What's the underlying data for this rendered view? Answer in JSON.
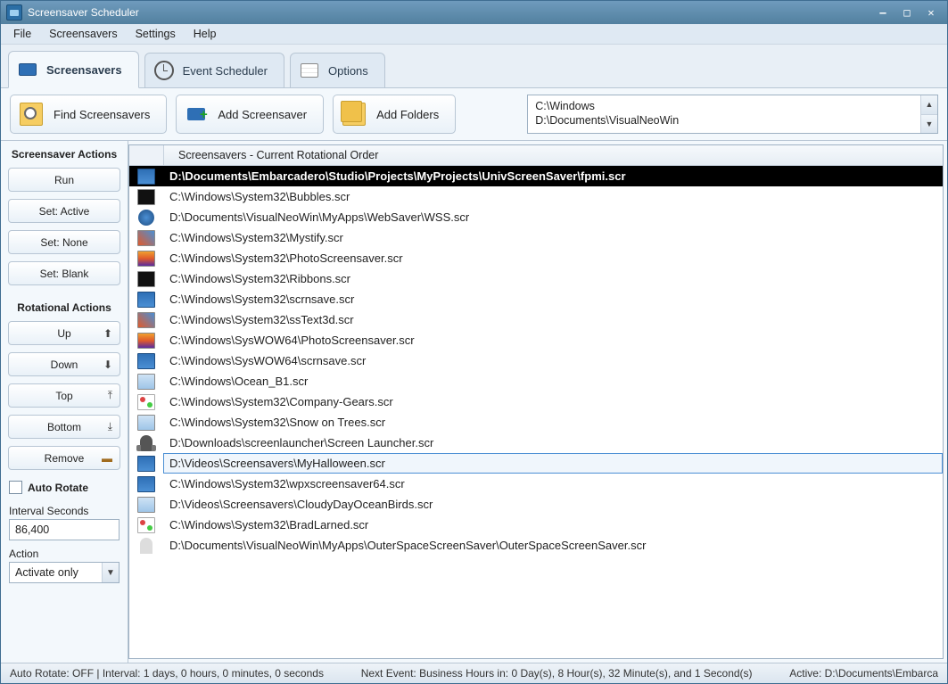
{
  "title": "Screensaver Scheduler",
  "menubar": [
    "File",
    "Screensavers",
    "Settings",
    "Help"
  ],
  "tabs": {
    "screensavers": "Screensavers",
    "scheduler": "Event Scheduler",
    "options": "Options"
  },
  "toolbar": {
    "find": "Find Screensavers",
    "add": "Add Screensaver",
    "folders": "Add Folders",
    "paths": [
      "C:\\Windows",
      "D:\\Documents\\VisualNeoWin"
    ]
  },
  "side": {
    "section_actions": "Screensaver Actions",
    "run": "Run",
    "set_active": "Set: Active",
    "set_none": "Set: None",
    "set_blank": "Set: Blank",
    "section_rotational": "Rotational Actions",
    "up": "Up",
    "down": "Down",
    "top": "Top",
    "bottom": "Bottom",
    "remove": "Remove",
    "auto_rotate": "Auto Rotate",
    "interval_label": "Interval Seconds",
    "interval_value": "86,400",
    "action_label": "Action",
    "action_value": "Activate only"
  },
  "list": {
    "header": "Screensavers - Current Rotational Order",
    "rows": [
      {
        "icon": "mi-monitor",
        "path": "D:\\Documents\\Embarcadero\\Studio\\Projects\\MyProjects\\UnivScreenSaver\\fpmi.scr",
        "state": "selected"
      },
      {
        "icon": "mi-black",
        "path": "C:\\Windows\\System32\\Bubbles.scr",
        "state": ""
      },
      {
        "icon": "mi-circle",
        "path": "D:\\Documents\\VisualNeoWin\\MyApps\\WebSaver\\WSS.scr",
        "state": ""
      },
      {
        "icon": "mi-gradient",
        "path": "C:\\Windows\\System32\\Mystify.scr",
        "state": ""
      },
      {
        "icon": "mi-sunset",
        "path": "C:\\Windows\\System32\\PhotoScreensaver.scr",
        "state": ""
      },
      {
        "icon": "mi-black",
        "path": "C:\\Windows\\System32\\Ribbons.scr",
        "state": ""
      },
      {
        "icon": "mi-monitor",
        "path": "C:\\Windows\\System32\\scrnsave.scr",
        "state": ""
      },
      {
        "icon": "mi-gradient",
        "path": "C:\\Windows\\System32\\ssText3d.scr",
        "state": ""
      },
      {
        "icon": "mi-sunset",
        "path": "C:\\Windows\\SysWOW64\\PhotoScreensaver.scr",
        "state": ""
      },
      {
        "icon": "mi-monitor",
        "path": "C:\\Windows\\SysWOW64\\scrnsave.scr",
        "state": ""
      },
      {
        "icon": "mi-pale",
        "path": "C:\\Windows\\Ocean_B1.scr",
        "state": ""
      },
      {
        "icon": "mi-gears",
        "path": "C:\\Windows\\System32\\Company-Gears.scr",
        "state": ""
      },
      {
        "icon": "mi-pale",
        "path": "C:\\Windows\\System32\\Snow on Trees.scr",
        "state": ""
      },
      {
        "icon": "mi-rocket",
        "path": "D:\\Downloads\\screenlauncher\\Screen Launcher.scr",
        "state": ""
      },
      {
        "icon": "mi-monitor",
        "path": "D:\\Videos\\Screensavers\\MyHalloween.scr",
        "state": "outlined"
      },
      {
        "icon": "mi-monitor",
        "path": "C:\\Windows\\System32\\wpxscreensaver64.scr",
        "state": ""
      },
      {
        "icon": "mi-pale",
        "path": "D:\\Videos\\Screensavers\\CloudyDayOceanBirds.scr",
        "state": ""
      },
      {
        "icon": "mi-gears",
        "path": "C:\\Windows\\System32\\BradLarned.scr",
        "state": ""
      },
      {
        "icon": "mi-ghost",
        "path": "D:\\Documents\\VisualNeoWin\\MyApps\\OuterSpaceScreenSaver\\OuterSpaceScreenSaver.scr",
        "state": ""
      }
    ]
  },
  "status": {
    "left": "Auto Rotate: OFF | Interval: 1 days, 0 hours, 0 minutes, 0 seconds",
    "center": "Next Event: Business Hours in: 0 Day(s), 8 Hour(s), 32 Minute(s), and 1 Second(s)",
    "right": "Active: D:\\Documents\\Embarca"
  }
}
